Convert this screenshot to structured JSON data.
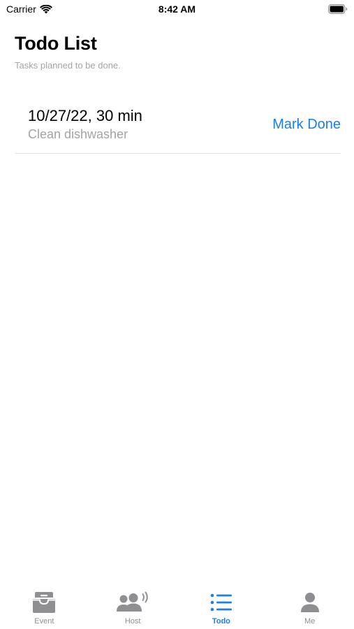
{
  "status_bar": {
    "carrier": "Carrier",
    "time": "8:42 AM"
  },
  "header": {
    "title": "Todo List",
    "subtitle": "Tasks planned to be done."
  },
  "tasks": [
    {
      "when": "10/27/22, 30 min",
      "description": "Clean dishwasher",
      "action_label": "Mark Done"
    }
  ],
  "tab_bar": {
    "tabs": [
      {
        "label": "Event",
        "icon": "tray-icon",
        "active": false
      },
      {
        "label": "Host",
        "icon": "people-broadcast-icon",
        "active": false
      },
      {
        "label": "Todo",
        "icon": "list-icon",
        "active": true
      },
      {
        "label": "Me",
        "icon": "person-icon",
        "active": false
      }
    ]
  },
  "colors": {
    "accent": "#1a7fe8",
    "inactive_tab": "#8e8e93",
    "secondary_text": "#a3a3a8",
    "separator": "#e3e3e6"
  }
}
